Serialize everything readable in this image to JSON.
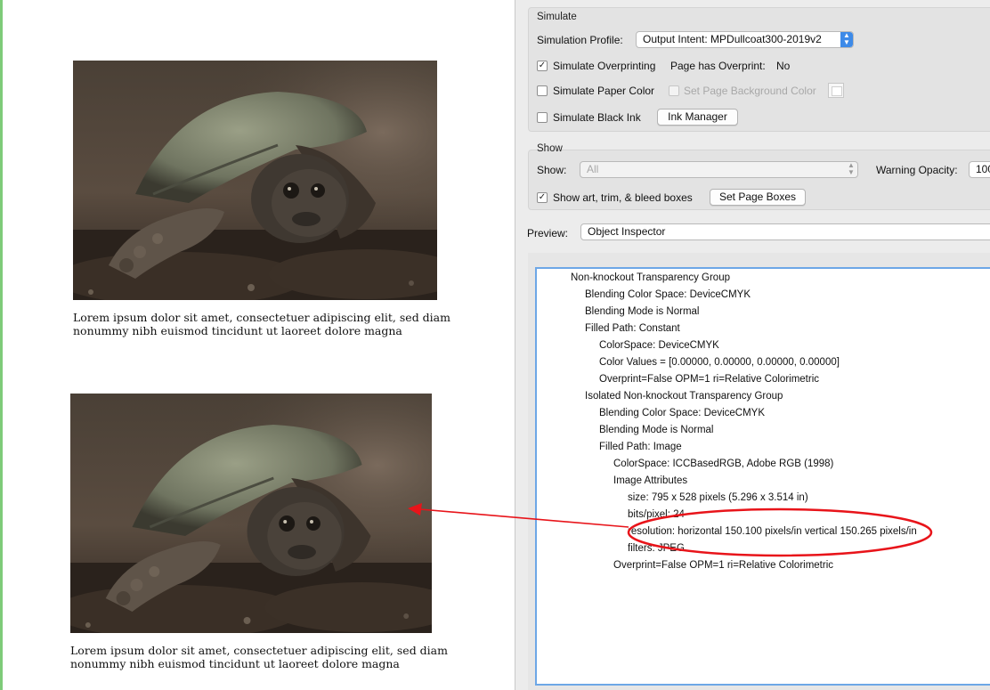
{
  "document": {
    "caption_1": "Lorem ipsum dolor sit amet, consectetuer adipiscing elit, sed diam nonummy nibh euismod tincidunt ut laoreet dolore magna",
    "caption_2": "Lorem ipsum dolor sit amet, consectetuer adipiscing elit, sed diam nonummy nibh euismod tincidunt ut laoreet dolore magna"
  },
  "simulate": {
    "group_title": "Simulate",
    "profile_label": "Simulation Profile:",
    "profile_value": "Output Intent: MPDullcoat300-2019v2",
    "overprinting_label": "Simulate Overprinting",
    "overprinting_checked": true,
    "page_has_overprint_label": "Page has Overprint:",
    "page_has_overprint_value": "No",
    "paper_color_label": "Simulate Paper Color",
    "paper_color_checked": false,
    "page_background_label": "Set Page Background Color",
    "black_ink_label": "Simulate Black Ink",
    "black_ink_checked": false,
    "ink_manager_label": "Ink Manager"
  },
  "show": {
    "group_title": "Show",
    "show_label": "Show:",
    "show_value": "All",
    "warning_opacity_label": "Warning Opacity:",
    "warning_opacity_value": "100",
    "boxes_label": "Show art, trim, & bleed boxes",
    "boxes_checked": true,
    "set_page_boxes_label": "Set Page Boxes"
  },
  "preview": {
    "label": "Preview:",
    "value": "Object Inspector"
  },
  "inspector": {
    "lines": [
      {
        "text": "Non-knockout Transparency Group",
        "level": 0
      },
      {
        "text": "Blending Color Space: DeviceCMYK",
        "level": 1
      },
      {
        "text": "Blending Mode is Normal",
        "level": 1
      },
      {
        "text": "Filled Path: Constant",
        "level": 1
      },
      {
        "text": "ColorSpace: DeviceCMYK",
        "level": 2
      },
      {
        "text": "Color Values = [0.00000, 0.00000, 0.00000, 0.00000]",
        "level": 2
      },
      {
        "text": "Overprint=False OPM=1 ri=Relative Colorimetric",
        "level": 2
      },
      {
        "text": "Isolated Non-knockout Transparency Group",
        "level": 1
      },
      {
        "text": "Blending Color Space: DeviceCMYK",
        "level": 2
      },
      {
        "text": "Blending Mode is Normal",
        "level": 2
      },
      {
        "text": "Filled Path: Image",
        "level": 2
      },
      {
        "text": "ColorSpace: ICCBasedRGB, Adobe RGB (1998)",
        "level": 3
      },
      {
        "text": "Image Attributes",
        "level": 3
      },
      {
        "text": "size: 795 x 528 pixels (5.296 x 3.514 in)",
        "level": 4
      },
      {
        "text": "bits/pixel: 24",
        "level": 4
      },
      {
        "text": "resolution: horizontal 150.100 pixels/in vertical 150.265 pixels/in",
        "level": 4
      },
      {
        "text": "filters: JPEG",
        "level": 4
      },
      {
        "text": "Overprint=False OPM=1 ri=Relative Colorimetric",
        "level": 3
      }
    ]
  },
  "annotation": {
    "color": "#e8141a"
  },
  "colors": {
    "accent": "#3d8ae8",
    "panel_bg": "#ececec",
    "page_edge": "#7ecb79"
  }
}
